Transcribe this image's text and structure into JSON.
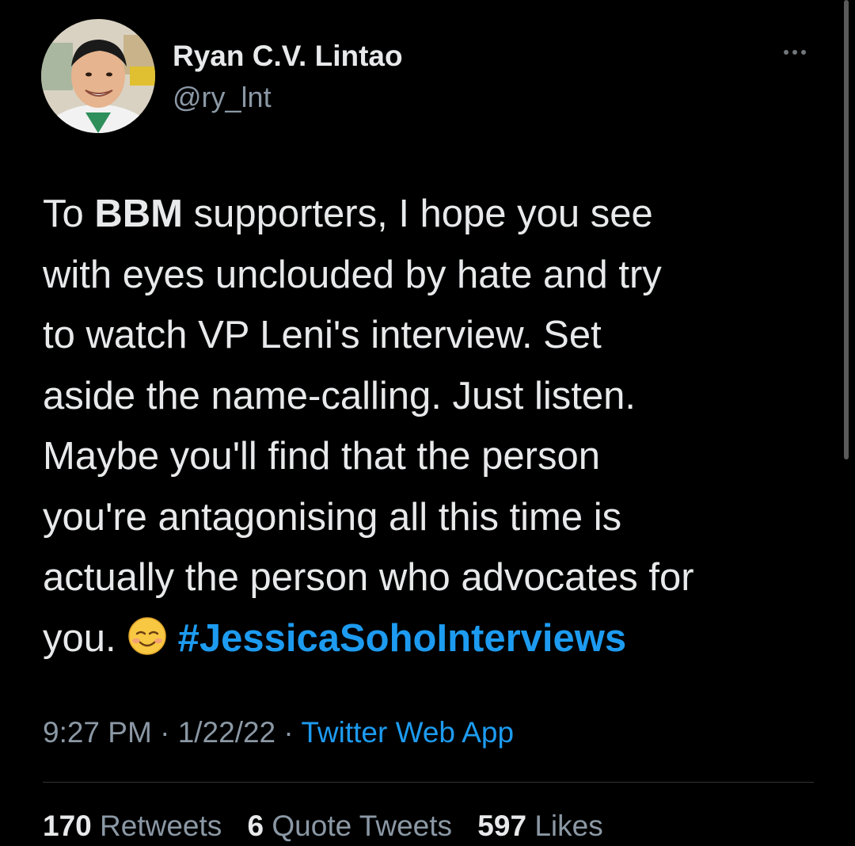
{
  "tweet": {
    "author": {
      "display_name": "Ryan C.V. Lintao",
      "handle": "@ry_lnt"
    },
    "text_parts": {
      "line1_a": "To ",
      "line1_bold": "BBM",
      "line1_b": " supporters, I hope you see",
      "line2": "with eyes unclouded by hate and try",
      "line3": "to watch VP Leni's interview. Set",
      "line4": "aside the name-calling. Just listen.",
      "line5": "Maybe you'll find that the person",
      "line6": "you're antagonising all this time is",
      "line7": "actually the person who advocates for",
      "line8": "you."
    },
    "emoji_icon": "smiling-face-icon",
    "hashtag": "#JessicaSohoInterviews",
    "time": "9:27 PM",
    "separator": " · ",
    "date": "1/22/22",
    "source": "Twitter Web App"
  },
  "stats": {
    "retweets_count": "170",
    "retweets_label": "Retweets",
    "quotes_count": "6",
    "quotes_label": "Quote Tweets",
    "likes_count": "597",
    "likes_label": "Likes"
  },
  "colors": {
    "background": "#000000",
    "text": "#e7e9ea",
    "secondary": "#8b98a5",
    "link": "#1d9bf0"
  }
}
